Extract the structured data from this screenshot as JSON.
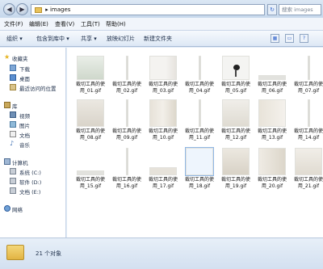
{
  "address": {
    "path": "images"
  },
  "search": {
    "placeholder": "搜索 images"
  },
  "menu": [
    "文件(F)",
    "编辑(E)",
    "查看(V)",
    "工具(T)",
    "帮助(H)"
  ],
  "toolbar": {
    "organize": "组织 ▾",
    "include": "包含到库中 ▾",
    "share": "共享 ▾",
    "slideshow": "放映幻灯片",
    "newfolder": "新建文件夹"
  },
  "nav": {
    "favorites": "收藏夹",
    "downloads": "下载",
    "desktop": "桌面",
    "recent": "最近访问的位置",
    "libraries": "库",
    "videos": "视频",
    "pictures": "图片",
    "documents": "文档",
    "music": "音乐",
    "computer": "计算机",
    "drive_c": "系统 (C:)",
    "drive_d": "软件 (D:)",
    "drive_e": "文档 (E:)",
    "network": "网络"
  },
  "files": [
    [
      "裁切工具的使",
      "用_01.gif"
    ],
    [
      "裁切工具的使",
      "用_02.gif"
    ],
    [
      "裁切工具的使",
      "用_03.gif"
    ],
    [
      "裁切工具的使",
      "用_04.gif"
    ],
    [
      "裁切工具的使",
      "用_05.gif"
    ],
    [
      "裁切工具的使",
      "用_06.gif"
    ],
    [
      "裁切工具的使",
      "用_07.gif"
    ],
    [
      "裁切工具的使",
      "用_08.gif"
    ],
    [
      "裁切工具的使",
      "用_09.gif"
    ],
    [
      "裁切工具的使",
      "用_10.gif"
    ],
    [
      "裁切工具的使",
      "用_11.gif"
    ],
    [
      "裁切工具的使",
      "用_12.gif"
    ],
    [
      "裁切工具的使",
      "用_13.gif"
    ],
    [
      "裁切工具的使",
      "用_14.gif"
    ],
    [
      "裁切工具的使",
      "用_15.gif"
    ],
    [
      "裁切工具的使",
      "用_16.gif"
    ],
    [
      "裁切工具的使",
      "用_17.gif"
    ],
    [
      "裁切工具的使",
      "用_18.gif"
    ],
    [
      "裁切工具的使",
      "用_19.gif"
    ],
    [
      "裁切工具的使",
      "用_20.gif"
    ],
    [
      "裁切工具的使",
      "用_21.gif"
    ]
  ],
  "status": {
    "count": "21 个对象"
  }
}
